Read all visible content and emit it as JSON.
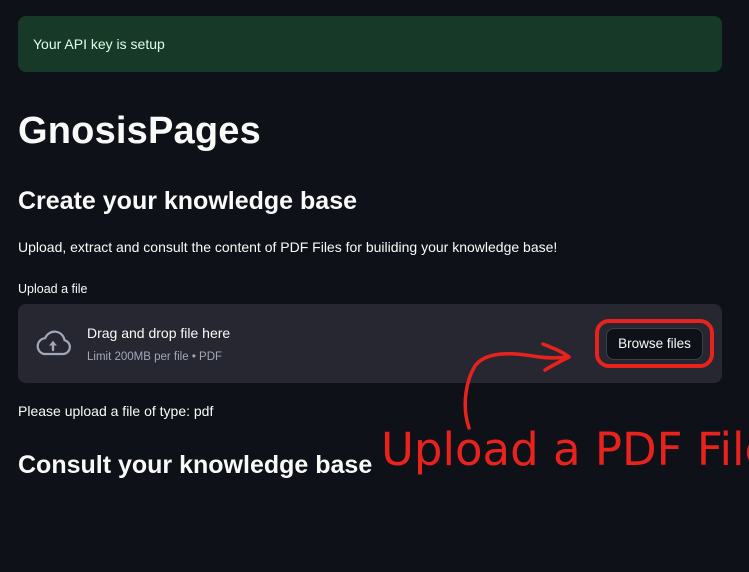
{
  "alert": {
    "message": "Your API key is setup"
  },
  "app": {
    "title": "GnosisPages"
  },
  "create_section": {
    "heading": "Create your knowledge base",
    "description": "Upload, extract and consult the content of PDF Files for builiding your knowledge base!",
    "upload_label": "Upload a file",
    "dropzone": {
      "icon": "cloud-upload-icon",
      "main_text": "Drag and drop file here",
      "sub_text": "Limit 200MB per file • PDF",
      "browse_label": "Browse files"
    },
    "status": "Please upload a file of type: pdf"
  },
  "consult_section": {
    "heading": "Consult your knowledge base"
  },
  "annotation": {
    "text": "Upload a PDF File",
    "color": "#e8231e"
  },
  "colors": {
    "background": "#0e1117",
    "alert_bg": "#173928",
    "alert_text": "#dffde9",
    "dropzone_bg": "#262730",
    "muted_text": "#a3a8b8"
  }
}
